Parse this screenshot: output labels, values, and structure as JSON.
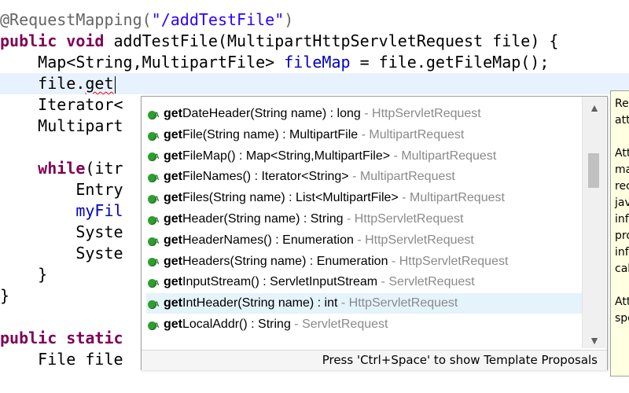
{
  "editor": {
    "lines": [
      {
        "segments": [
          {
            "t": "@RequestMapping(",
            "c": "ann"
          },
          {
            "t": "\"/addTestFile\"",
            "c": "str"
          },
          {
            "t": ")",
            "c": "ann"
          }
        ]
      },
      {
        "segments": [
          {
            "t": "public",
            "c": "kw"
          },
          {
            "t": " "
          },
          {
            "t": "void",
            "c": "kw"
          },
          {
            "t": " addTestFile(MultipartHttpServletRequest file) {"
          }
        ]
      },
      {
        "segments": [
          {
            "t": "    Map<String,MultipartFile> "
          },
          {
            "t": "fileMap",
            "c": "fld"
          },
          {
            "t": " = file.getFileMap();"
          }
        ]
      },
      {
        "segments": [
          {
            "t": "    file."
          },
          {
            "t": "get",
            "c": "squig"
          }
        ],
        "current": true,
        "caret": true
      },
      {
        "segments": [
          {
            "t": "    Iterator<"
          }
        ]
      },
      {
        "segments": [
          {
            "t": "    Multipart"
          }
        ]
      },
      {
        "segments": [
          {
            "t": ""
          }
        ]
      },
      {
        "segments": [
          {
            "t": "    "
          },
          {
            "t": "while",
            "c": "kw"
          },
          {
            "t": "(itr"
          }
        ]
      },
      {
        "segments": [
          {
            "t": "        Entry"
          }
        ]
      },
      {
        "segments": [
          {
            "t": "        "
          },
          {
            "t": "myFil",
            "c": "fld"
          }
        ]
      },
      {
        "segments": [
          {
            "t": "        Syste"
          }
        ]
      },
      {
        "segments": [
          {
            "t": "        Syste"
          }
        ]
      },
      {
        "segments": [
          {
            "t": "    }"
          }
        ]
      },
      {
        "segments": [
          {
            "t": "}"
          }
        ]
      },
      {
        "segments": [
          {
            "t": ""
          }
        ]
      },
      {
        "segments": [
          {
            "t": "public",
            "c": "kw"
          },
          {
            "t": " "
          },
          {
            "t": "static",
            "c": "kw"
          }
        ]
      },
      {
        "segments": [
          {
            "t": "    File file"
          }
        ]
      }
    ]
  },
  "autocomplete": {
    "items": [
      {
        "name": "getDateHeader",
        "sig": "(String name) : long",
        "src": "HttpServletRequest"
      },
      {
        "name": "getFile",
        "sig": "(String name) : MultipartFile",
        "src": "MultipartRequest"
      },
      {
        "name": "getFileMap",
        "sig": "() : Map<String,MultipartFile>",
        "src": "MultipartRequest"
      },
      {
        "name": "getFileNames",
        "sig": "() : Iterator<String>",
        "src": "MultipartRequest"
      },
      {
        "name": "getFiles",
        "sig": "(String name) : List<MultipartFile>",
        "src": "MultipartRequest"
      },
      {
        "name": "getHeader",
        "sig": "(String name) : String",
        "src": "HttpServletRequest"
      },
      {
        "name": "getHeaderNames",
        "sig": "() : Enumeration",
        "src": "HttpServletRequest"
      },
      {
        "name": "getHeaders",
        "sig": "(String name) : Enumeration",
        "src": "HttpServletRequest"
      },
      {
        "name": "getInputStream",
        "sig": "() : ServletInputStream",
        "src": "ServletRequest"
      },
      {
        "name": "getIntHeader",
        "sig": "(String name) : int",
        "src": "HttpServletRequest",
        "selected": true
      },
      {
        "name": "getLocalAddr",
        "sig": "() : String",
        "src": "ServletRequest"
      }
    ],
    "match_prefix": "get",
    "sep": " - ",
    "footer": "Press 'Ctrl+Space' to show Template Proposals",
    "icon": "public-method-icon",
    "icon_color": "#2e9e2e",
    "scroll_up": "▲",
    "scroll_down": "▼"
  },
  "doc_panel": {
    "lines": [
      "Re",
      "att",
      "",
      "Att",
      "ma",
      "rec",
      "jav",
      "inf",
      "pro",
      "inf",
      "cal",
      "",
      "Att",
      "spe"
    ]
  }
}
